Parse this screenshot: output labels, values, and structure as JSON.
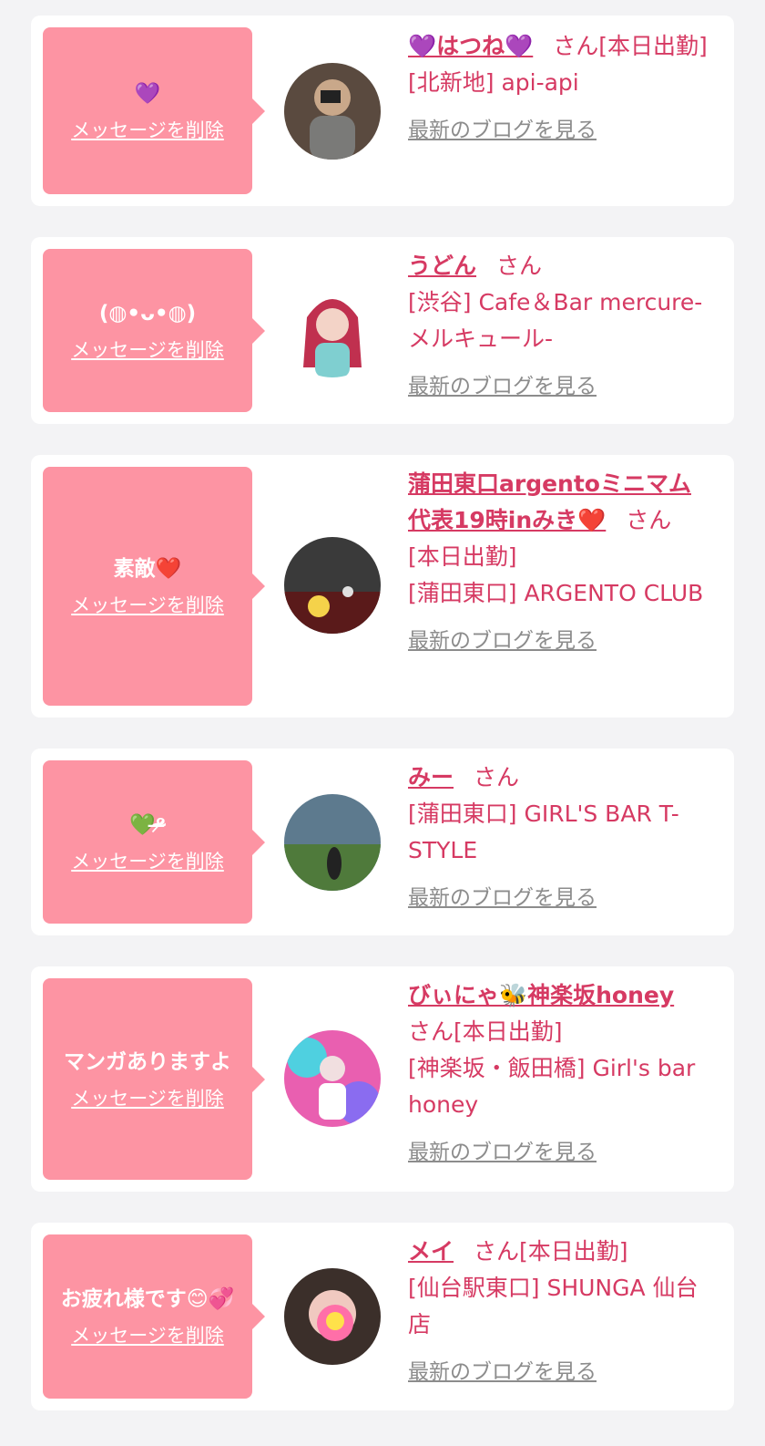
{
  "delete_label": "メッセージを削除",
  "san_label": "さん",
  "blog_label": "最新のブログを見る",
  "colors": {
    "accent_pink": "#fd94a3",
    "name_red": "#d63a63",
    "link_gray": "#8c8c8c",
    "background": "#f3f3f5"
  },
  "cards": [
    {
      "message": "💜",
      "name": "💜はつね💜",
      "status": "[本日出勤]",
      "shop": "[北新地] api-api",
      "avatar_icon": "avatar-photo"
    },
    {
      "message": "(◍•ᴗ•◍)",
      "name": "うどん",
      "status": "",
      "shop": "[渋谷] Cafe＆Bar mercure-メルキュール-",
      "avatar_icon": "avatar-photo"
    },
    {
      "message": "素敵❤️",
      "name": "蒲田東口argentoミニマム代表19時inみき❤️",
      "status": "[本日出勤]",
      "shop": "[蒲田東口] ARGENTO CLUB",
      "avatar_icon": "avatar-photo"
    },
    {
      "message": "💚ᵒ̴̶̷",
      "name": "みー",
      "status": "",
      "shop": "[蒲田東口] GIRL'S BAR T-STYLE",
      "avatar_icon": "avatar-photo"
    },
    {
      "message": "マンガありますよ",
      "name": "びぃにゃ🐝神楽坂honey",
      "status": "[本日出勤]",
      "shop": "[神楽坂・飯田橋] Girl's bar honey",
      "avatar_icon": "avatar-photo"
    },
    {
      "message": "お疲れ様です😊💞",
      "name": "メイ",
      "status": "[本日出勤]",
      "shop": "[仙台駅東口] SHUNGA 仙台店",
      "avatar_icon": "avatar-photo"
    }
  ]
}
